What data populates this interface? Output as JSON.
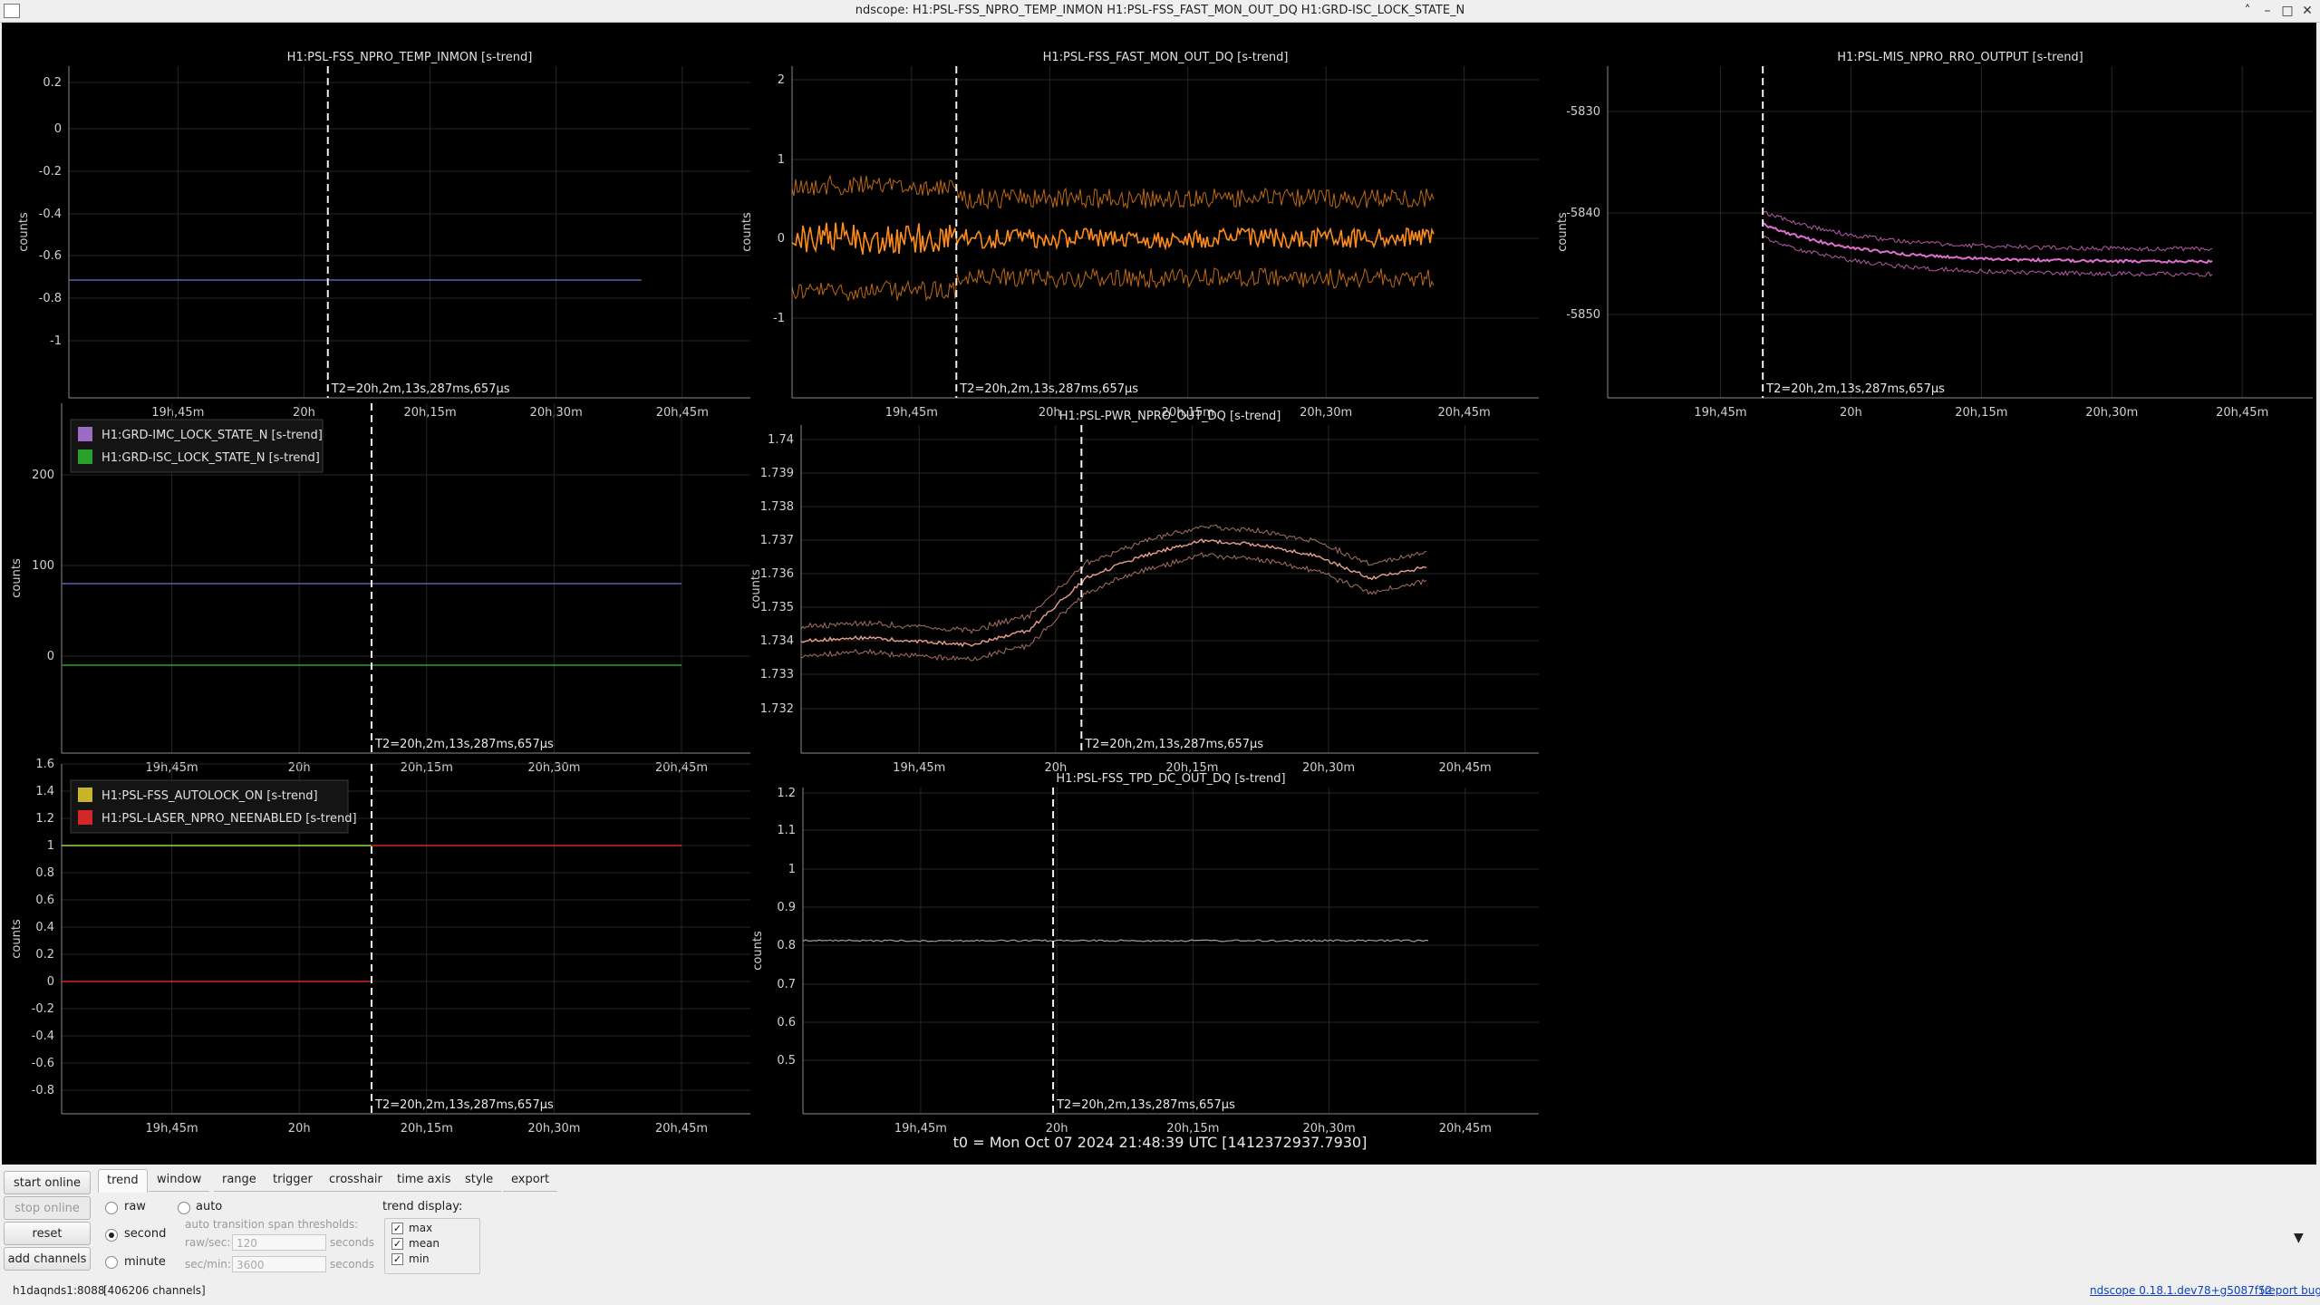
{
  "window": {
    "title": "ndscope: H1:PSL-FSS_NPRO_TEMP_INMON H1:PSL-FSS_FAST_MON_OUT_DQ H1:GRD-ISC_LOCK_STATE_N",
    "buttons": [
      "minimize-alt",
      "minimize",
      "maximize",
      "close"
    ]
  },
  "t0_label": "t0 = Mon Oct 07 2024 21:48:39 UTC [1412372937.7930]",
  "cursor_label": "T2=20h,2m,13s,287ms,657µs",
  "x_ticks": [
    "19h,45m",
    "20h",
    "20h,15m",
    "20h,30m",
    "20h,45m"
  ],
  "y_axis_label": "counts",
  "plots": [
    {
      "title": "H1:PSL-FSS_NPRO_TEMP_INMON [s-trend]",
      "y_ticks": [
        "0.2",
        "0",
        "-0.2",
        "-0.4",
        "-0.6",
        "-0.8",
        "-1"
      ],
      "legend": []
    },
    {
      "title": "H1:PSL-FSS_FAST_MON_OUT_DQ [s-trend]",
      "y_ticks": [
        "2",
        "1",
        "0",
        "-1"
      ],
      "legend": []
    },
    {
      "title": "H1:PSL-MIS_NPRO_RRO_OUTPUT [s-trend]",
      "y_ticks": [
        "-5830",
        "-5840",
        "-5850"
      ],
      "legend": []
    },
    {
      "title": "",
      "y_ticks": [
        "200",
        "100",
        "0"
      ],
      "legend": [
        {
          "label": "H1:GRD-IMC_LOCK_STATE_N [s-trend]",
          "color": "#9b6bc6"
        },
        {
          "label": "H1:GRD-ISC_LOCK_STATE_N [s-trend]",
          "color": "#2ca02c"
        }
      ]
    },
    {
      "title": "H1:PSL-PWR_NPRO_OUT_DQ [s-trend]",
      "y_ticks": [
        "1.74",
        "1.739",
        "1.738",
        "1.737",
        "1.736",
        "1.735",
        "1.734",
        "1.733",
        "1.732"
      ],
      "legend": []
    },
    {
      "title": "",
      "y_ticks": [
        "1.6",
        "1.4",
        "1.2",
        "1",
        "0.8",
        "0.6",
        "0.4",
        "0.2",
        "0",
        "-0.2",
        "-0.4",
        "-0.6",
        "-0.8"
      ],
      "legend": [
        {
          "label": "H1:PSL-FSS_AUTOLOCK_ON [s-trend]",
          "color": "#c8b42a"
        },
        {
          "label": "H1:PSL-LASER_NPRO_NEENABLED [s-trend]",
          "color": "#d62728"
        }
      ]
    },
    {
      "title": "H1:PSL-FSS_TPD_DC_OUT_DQ [s-trend]",
      "y_ticks": [
        "1.2",
        "1.1",
        "1",
        "0.9",
        "0.8",
        "0.7",
        "0.6",
        "0.5"
      ],
      "legend": []
    }
  ],
  "series_colors": {
    "temp": "#5566aa",
    "fast_mon": "#ff8c1a",
    "rro": "#e070d0",
    "imc_lock": "#5a5fb0",
    "isc_lock": "#2ca02c",
    "pwr": "#e9a08c",
    "autolock": "#9ad64a",
    "neenabled": "#d62728",
    "tpd": "#a0a0a0"
  },
  "chart_data": [
    {
      "type": "line",
      "title": "H1:PSL-FSS_NPRO_TEMP_INMON [s-trend]",
      "ylabel": "counts",
      "ylim": [
        -1.15,
        0.3
      ],
      "series": [
        {
          "name": "H1:PSL-FSS_NPRO_TEMP_INMON",
          "values": [
            -0.71
          ]
        }
      ]
    },
    {
      "type": "line",
      "title": "H1:PSL-FSS_FAST_MON_OUT_DQ [s-trend]",
      "ylabel": "counts",
      "ylim": [
        -1.7,
        2.1
      ],
      "series": [
        {
          "name": "H1:PSL-FSS_FAST_MON_OUT_DQ",
          "mean": 0,
          "max": 0.45,
          "min": -0.45
        }
      ]
    },
    {
      "type": "line",
      "title": "H1:PSL-MIS_NPRO_RRO_OUTPUT [s-trend]",
      "ylabel": "counts",
      "ylim": [
        -5856,
        -5826
      ],
      "series": [
        {
          "name": "H1:PSL-MIS_NPRO_RRO_OUTPUT",
          "start": -5841,
          "end": -5846
        }
      ]
    },
    {
      "type": "line",
      "ylabel": "counts",
      "ylim": [
        -90,
        280
      ],
      "series": [
        {
          "name": "H1:GRD-IMC_LOCK_STATE_N",
          "values": [
            80
          ]
        },
        {
          "name": "H1:GRD-ISC_LOCK_STATE_N",
          "values": [
            -10
          ]
        }
      ]
    },
    {
      "type": "line",
      "title": "H1:PSL-PWR_NPRO_OUT_DQ [s-trend]",
      "ylabel": "counts",
      "ylim": [
        1.7315,
        1.7403
      ],
      "series": [
        {
          "name": "H1:PSL-PWR_NPRO_OUT_DQ",
          "values": [
            1.7345,
            1.7346,
            1.7345,
            1.7344,
            1.7348,
            1.7362,
            1.7368,
            1.7372,
            1.7371,
            1.7368,
            1.7362,
            1.7365
          ]
        }
      ]
    },
    {
      "type": "line",
      "ylabel": "counts",
      "ylim": [
        -0.85,
        1.62
      ],
      "series": [
        {
          "name": "H1:PSL-FSS_AUTOLOCK_ON",
          "values": [
            1
          ]
        },
        {
          "name": "H1:PSL-LASER_NPRO_NEENABLED",
          "values": [
            0,
            1
          ]
        }
      ]
    },
    {
      "type": "line",
      "title": "H1:PSL-FSS_TPD_DC_OUT_DQ [s-trend]",
      "ylabel": "counts",
      "ylim": [
        0.43,
        1.23
      ],
      "series": [
        {
          "name": "H1:PSL-FSS_TPD_DC_OUT_DQ",
          "values": [
            0.81
          ]
        }
      ]
    }
  ],
  "tabs": [
    "trend",
    "window",
    "range",
    "trigger",
    "crosshair",
    "time axis",
    "style",
    "export"
  ],
  "active_tab": "trend",
  "side_buttons": {
    "start_online": "start online",
    "stop_online": "stop online",
    "reset": "reset",
    "add_channels": "add channels"
  },
  "trend": {
    "raw": "raw",
    "auto": "auto",
    "second": "second",
    "minute": "minute",
    "selected": "second",
    "thresholds_label": "auto transition span thresholds:",
    "raw_sec_label": "raw/sec:",
    "raw_sec_value": "120",
    "sec_min_label": "sec/min:",
    "sec_min_value": "3600",
    "seconds_unit": "seconds",
    "display_label": "trend display:",
    "display_options": [
      {
        "label": "max",
        "checked": true
      },
      {
        "label": "mean",
        "checked": true
      },
      {
        "label": "min",
        "checked": true
      }
    ]
  },
  "status": {
    "server": "h1daqnds1:8088",
    "channels": "[406206 channels]",
    "version": "ndscope 0.18.1.dev78+g5087f52",
    "report": "(report bug)"
  }
}
